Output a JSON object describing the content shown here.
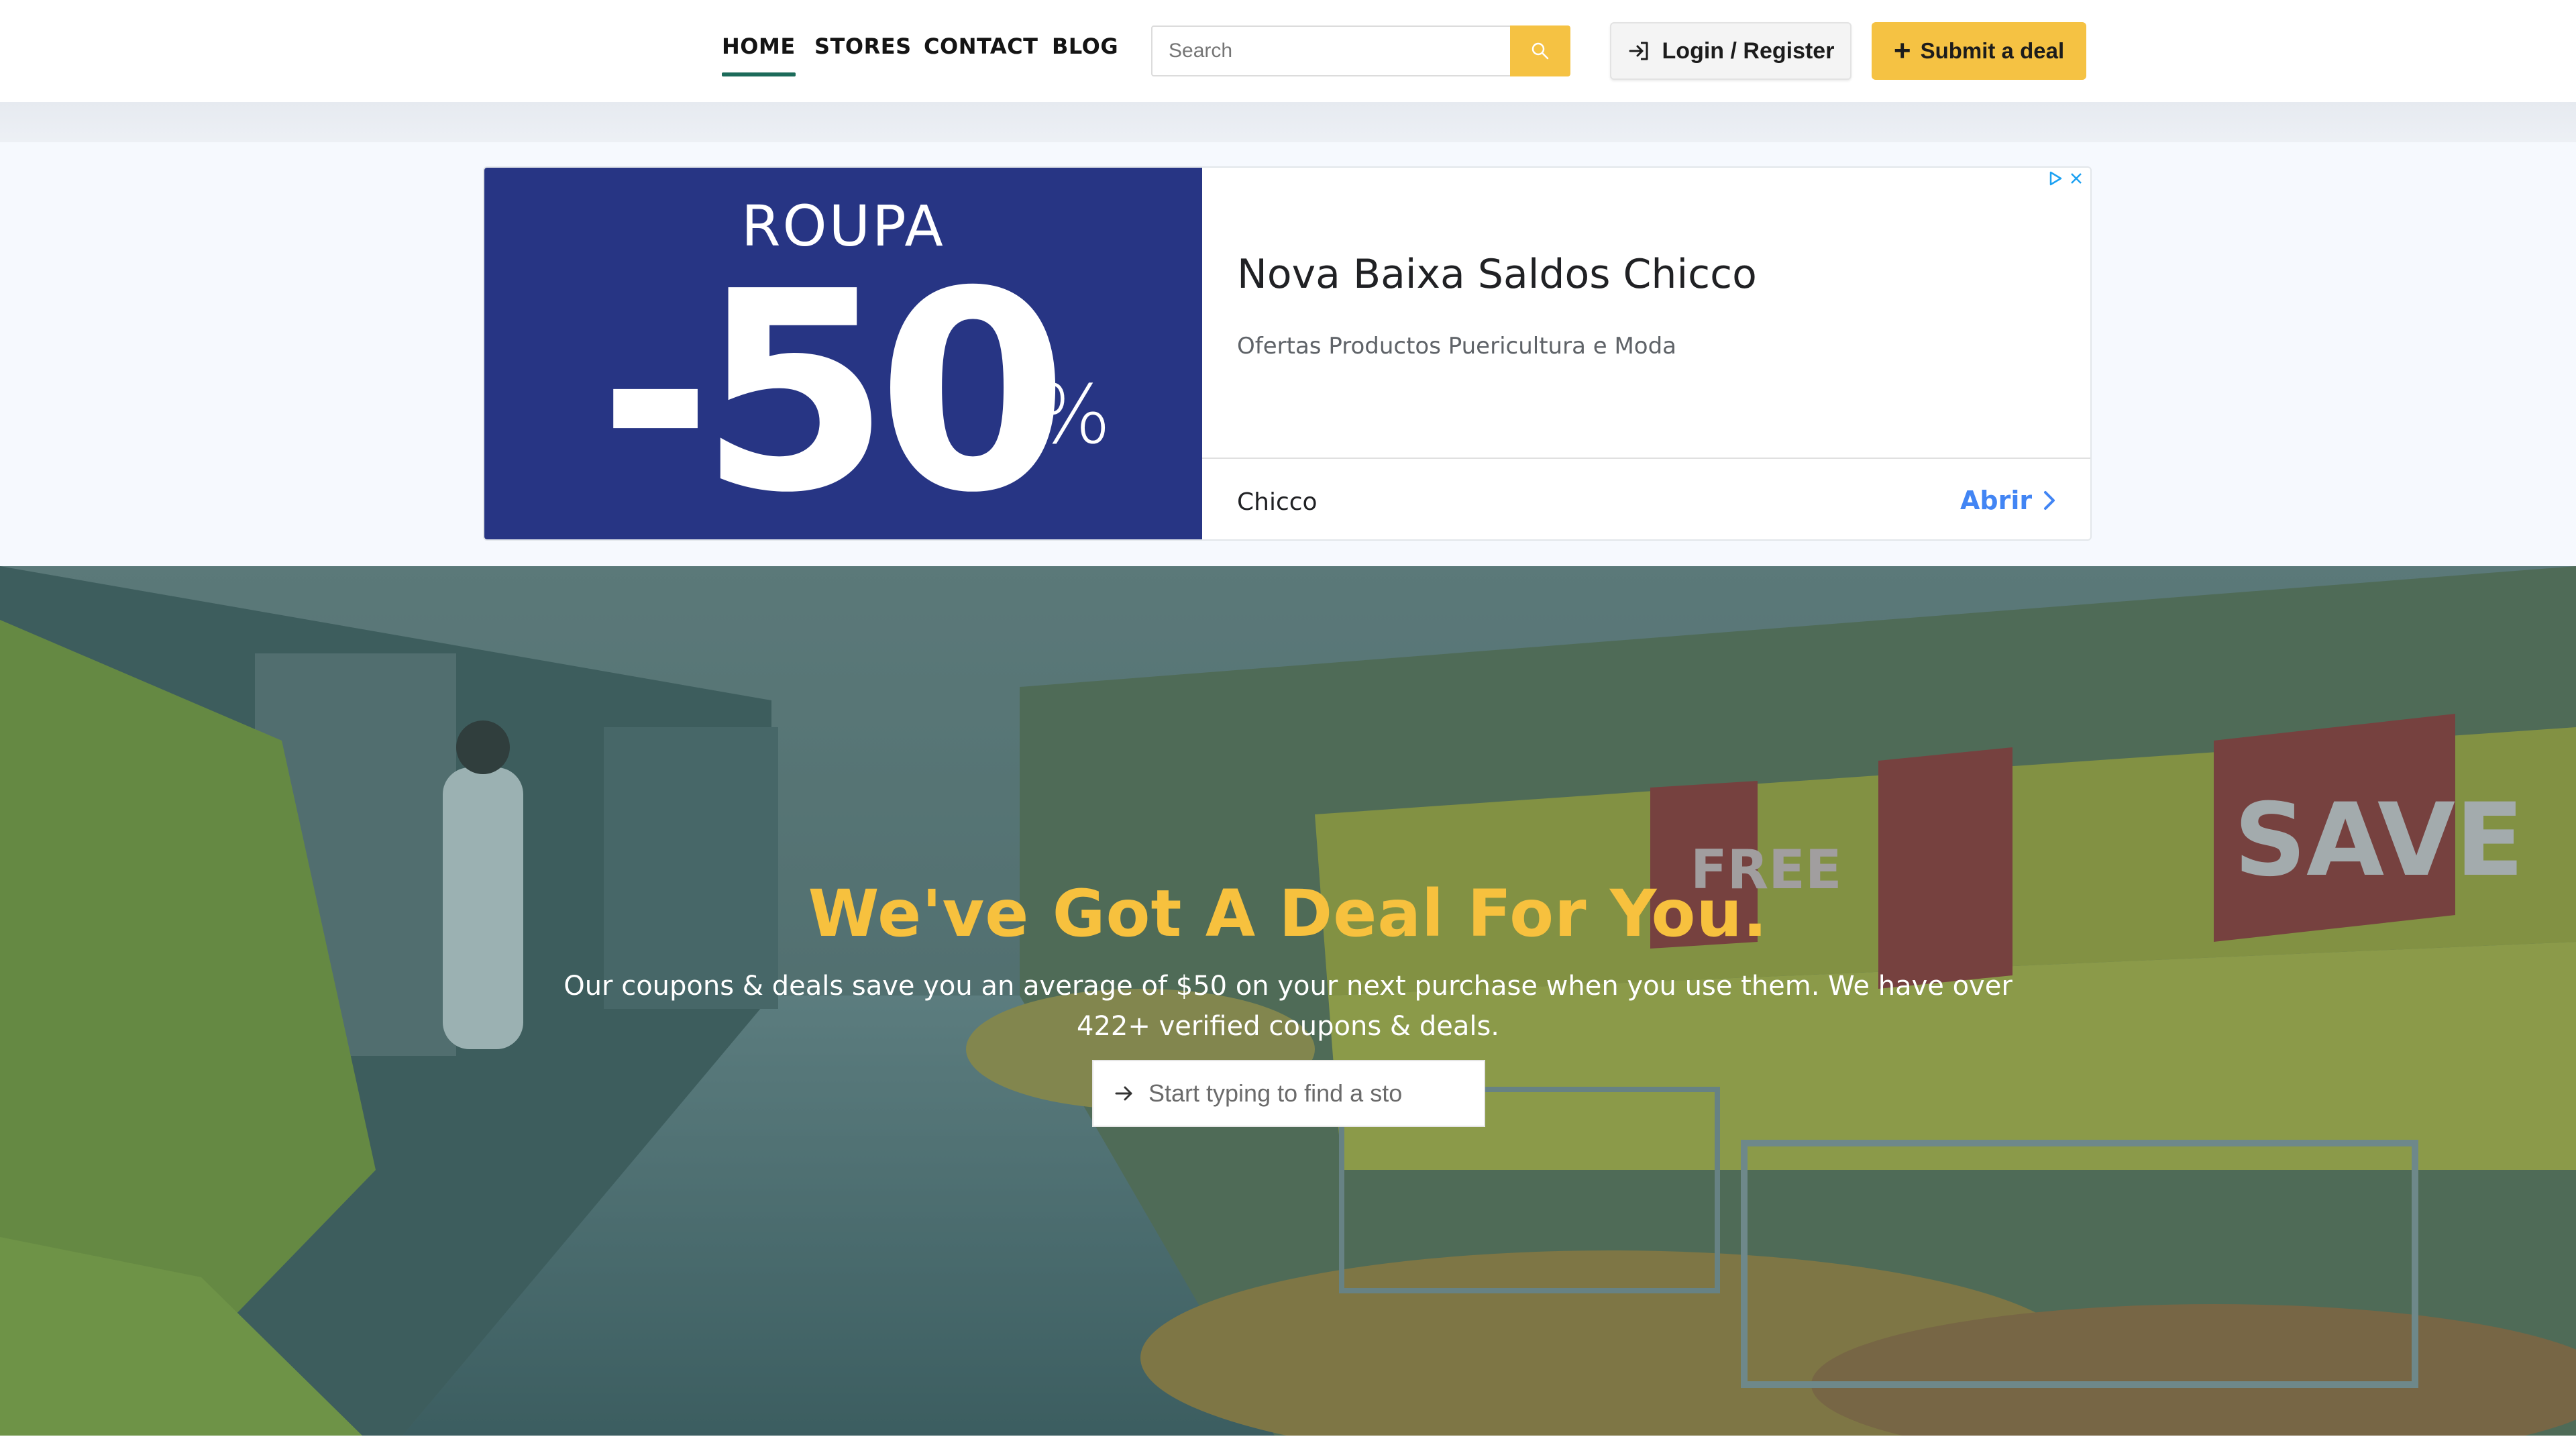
{
  "nav": {
    "items": [
      {
        "label": "HOME",
        "active": true
      },
      {
        "label": "STORES",
        "active": false
      },
      {
        "label": "CONTACT",
        "active": false
      },
      {
        "label": "BLOG",
        "active": false
      }
    ],
    "search_placeholder": "Search",
    "login_label": "Login / Register",
    "submit_label": "Submit a deal"
  },
  "ad": {
    "image_heading": "ROUPA",
    "image_discount": "-50",
    "image_percent": "%",
    "title": "Nova Baixa Saldos Chicco",
    "description": "Ofertas Productos Puericultura e Moda",
    "brand": "Chicco",
    "cta": "Abrir"
  },
  "hero": {
    "title": "We've Got A Deal For You.",
    "text": "Our coupons & deals save you an average of $50 on your next purchase when you use them. We have over 422+ verified coupons & deals.",
    "store_placeholder": "Start typing to find a sto"
  },
  "colors": {
    "accent": "#f5c243",
    "active_underline": "#1c6b5a",
    "ad_blue": "#273584",
    "hero_title": "#f7c13e",
    "link_blue": "#4285f4"
  }
}
